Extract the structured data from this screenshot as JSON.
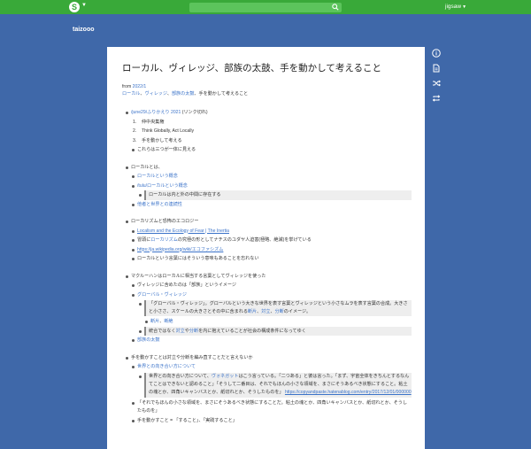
{
  "header": {
    "logo_letter": "S",
    "search_placeholder": "",
    "user_name": "jigsaw",
    "project_name": "taizooo"
  },
  "page": {
    "title": "ローカル、ヴィレッジ、部族の太鼓、手を動かして考えること",
    "from_label": "from",
    "from_link": "2022/1",
    "tags": [
      "ローカル",
      "ヴィレッジ",
      "部族の太鼓"
    ],
    "tag_suffix": "手を動かして考えること",
    "block1": {
      "head_link": "/june29/ふりかえり 2021",
      "head_suffix": "(リンク切れ)",
      "items": [
        "仲中央集権",
        "Think Globally, Act Locally",
        "手を動かして考える"
      ],
      "after": "これらは三つが一体に見える"
    },
    "block2": {
      "head": "ローカルとは、",
      "link1": "ローカルという概念",
      "link2": "/tulu/ローカルという概念",
      "quote": "ローカルは内と外の中間に存在する",
      "link3": "他者と世界との連続性"
    },
    "block3": {
      "head": "ローカリズムと恐怖のエコロジー",
      "link1": "Localism and the Ecology of Fear | The Inertia",
      "line2_pre": "冒頭に",
      "line2_link": "ローカリズム",
      "line2_post": "の究極の形としてナチスのユダヤ人迫害(極略、絶滅)を挙げている",
      "link3": "https://ja.wikipedia.org/wiki/エコファシズム",
      "line4": "ローカルという言葉にはそういう意味もあることを忘れない"
    },
    "block4": {
      "head": "マクルーハンはローカルに相当する言葉としてヴィレッジを使った",
      "line1": "ヴィレッジに含めたのは「部族」というイメージ",
      "link2": "グローバル・ヴィレッジ",
      "quote1_a": "「グローバル・ヴィレッジ」。グローバルという大きな世界を表す言葉とヴィレッジという小さな",
      "quote1_a2": "ムラを表す言葉の合成。大きさと小ささ、スケールの大きさとその中に含まれる",
      "quote1_link1": "断片",
      "quote1_sep": "、",
      "quote1_link2": "対立",
      "quote1_sep2": "、",
      "quote1_link3": "分断",
      "quote1_end": "のイメージ。",
      "sub_link1": "断片",
      "sub_sep": "、",
      "sub_link2": "断絶",
      "quote2_pre": "統合ではなく",
      "quote2_link1": "対立",
      "quote2_mid": "や",
      "quote2_link2": "分断",
      "quote2_post": "を内に抱えていることが社会の構成条件になってゆく",
      "link_last": "部族の太鼓"
    },
    "block5": {
      "head": "手を動かすことは対立や分断を編み直すことだと言えないか",
      "link1": "世界との向き合い方について",
      "quote_a": "世界との向き合い方について、",
      "quote_link": "ヴォネガット",
      "quote_b": "はこう言っている。「二つある」と彼は言った。「まず、宇宙全体をきちんとするなんてことはできないと認めること」「そうして二番目は、それでもほんの小さな領域を、まさにそうあるべき状態にすること。粘土の塊とか、四角いキャンバスとか、紙切れとか、そうしたものを」",
      "quote_url": "https://copyandpaste.hatenablog.com/entry/2017/12/01/000000",
      "line3": "「それでもほんの小さな領域を、まさにそうあるべき状態にすることだ。粘土の塊とか、四角いキャンバスとか、紙切れとか、そうしたものを」",
      "line4": "手を動かすこと = 「すること」、「実践すること」"
    }
  }
}
